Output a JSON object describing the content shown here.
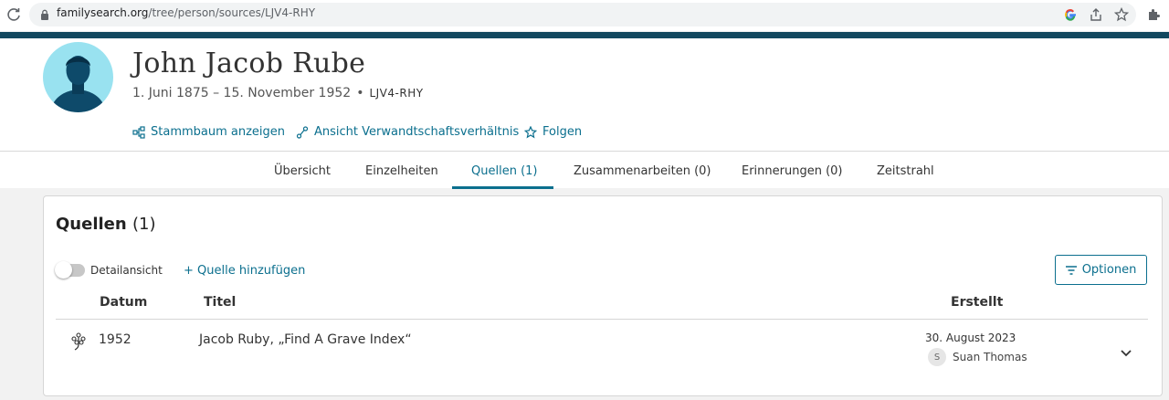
{
  "browser": {
    "url_host": "familysearch.org",
    "url_path": "/tree/person/sources/LJV4-RHY",
    "icons": [
      "reload-icon",
      "lock-icon",
      "google-icon",
      "share-icon",
      "star-icon",
      "extensions-icon"
    ]
  },
  "person": {
    "name": "John Jacob Rube",
    "lifespan": "1. Juni 1875 – 15. November 1952",
    "separator": "•",
    "pid": "LJV4-RHY"
  },
  "actions": {
    "tree": "Stammbaum anzeigen",
    "relationship": "Ansicht Verwandtschaftsverhältnis",
    "follow": "Folgen"
  },
  "tabs": [
    {
      "label": "Übersicht",
      "active": false
    },
    {
      "label": "Einzelheiten",
      "active": false
    },
    {
      "label": "Quellen (1)",
      "active": true
    },
    {
      "label": "Zusammenarbeiten (0)",
      "active": false
    },
    {
      "label": "Erinnerungen (0)",
      "active": false
    },
    {
      "label": "Zeitstrahl",
      "active": false
    }
  ],
  "sources": {
    "title": "Quellen",
    "count": "(1)",
    "detail_toggle": "Detailansicht",
    "detail_on": false,
    "add": "+ Quelle hinzufügen",
    "options": "Optionen",
    "columns": {
      "date": "Datum",
      "title": "Titel",
      "created": "Erstellt"
    },
    "rows": [
      {
        "date": "1952",
        "title": "Jacob Ruby, „Find A Grave Index“",
        "created_date": "30. August 2023",
        "creator_initial": "S",
        "creator": "Suan Thomas"
      }
    ]
  },
  "colors": {
    "accent": "#0b6f8e",
    "band": "#12485f",
    "avatar_bg": "#99e2f0"
  }
}
